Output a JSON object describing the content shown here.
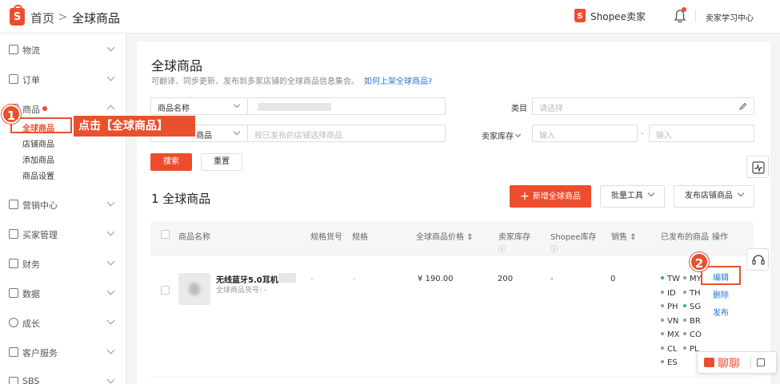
{
  "header": {
    "home": "首页",
    "separator": ">",
    "current": "全球商品",
    "brand": "Shopee卖家",
    "learning_center": "卖家学习中心"
  },
  "sidebar": {
    "items": [
      {
        "label": "物流",
        "icon": "truck-icon"
      },
      {
        "label": "订单",
        "icon": "clipboard-icon"
      },
      {
        "label": "商品",
        "icon": "box-icon",
        "expanded": true
      },
      {
        "label": "营销中心",
        "icon": "tag-icon"
      },
      {
        "label": "买家管理",
        "icon": "user-icon"
      },
      {
        "label": "财务",
        "icon": "wallet-icon"
      },
      {
        "label": "数据",
        "icon": "chart-icon"
      },
      {
        "label": "成长",
        "icon": "location-icon"
      },
      {
        "label": "客户服务",
        "icon": "chat-icon"
      },
      {
        "label": "SBS",
        "icon": "sbs-icon"
      }
    ],
    "product_sub": [
      "全球商品",
      "店铺商品",
      "添加商品",
      "商品设置"
    ]
  },
  "annotations": {
    "step1": "1",
    "step1_text": "点击【全球商品】",
    "step2": "2",
    "accent": "#e8512e"
  },
  "main": {
    "title": "全球商品",
    "description": "可翻译、同步更新、发布到多家店铺的全球商品信息集合。",
    "help_link": "如何上架全球商品?",
    "filters": {
      "name_select": "商品名称",
      "category_label": "类目",
      "category_placeholder": "请选择",
      "shop_select": "商品",
      "shop_placeholder": "按已发布的店铺选择商品",
      "stock_label": "卖家库存",
      "stock_min_placeholder": "输入",
      "stock_dash": "-",
      "stock_max_placeholder": "输入",
      "search_button": "搜索",
      "reset_button": "重置"
    },
    "count_text": "1 全球商品",
    "add_button": "新增全球商品",
    "bulk_button": "批量工具",
    "publish_button": "发布店铺商品",
    "table": {
      "headers": {
        "name": "商品名称",
        "sku": "规格货号",
        "spec": "规格",
        "price": "全球商品价格",
        "stock": "卖家库存",
        "shopee_stock": "Shopee库存",
        "sales": "销售",
        "published": "已发布的商品",
        "actions": "操作"
      },
      "row": {
        "name": "无线蓝牙5.0耳机",
        "sku_label": "全球商品货号: -",
        "sku": "-",
        "spec": "-",
        "price": "¥ 190.00",
        "stock": "200",
        "shopee_stock": "-",
        "sales": "0",
        "regions": [
          {
            "code": "TW",
            "color": "#2bb673"
          },
          {
            "code": "MY",
            "color": "#999999"
          },
          {
            "code": "ID",
            "color": "#999999"
          },
          {
            "code": "TH",
            "color": "#999999"
          },
          {
            "code": "PH",
            "color": "#999999"
          },
          {
            "code": "SG",
            "color": "#2bb673"
          },
          {
            "code": "VN",
            "color": "#999999"
          },
          {
            "code": "BR",
            "color": "#999999"
          },
          {
            "code": "MX",
            "color": "#999999"
          },
          {
            "code": "CO",
            "color": "#999999"
          },
          {
            "code": "CL",
            "color": "#999999"
          },
          {
            "code": "PL",
            "color": "#999999"
          },
          {
            "code": "ES",
            "color": "#999999"
          }
        ],
        "actions": [
          "编辑",
          "删除",
          "发布"
        ]
      }
    }
  },
  "chat": {
    "label": "聊聊"
  }
}
